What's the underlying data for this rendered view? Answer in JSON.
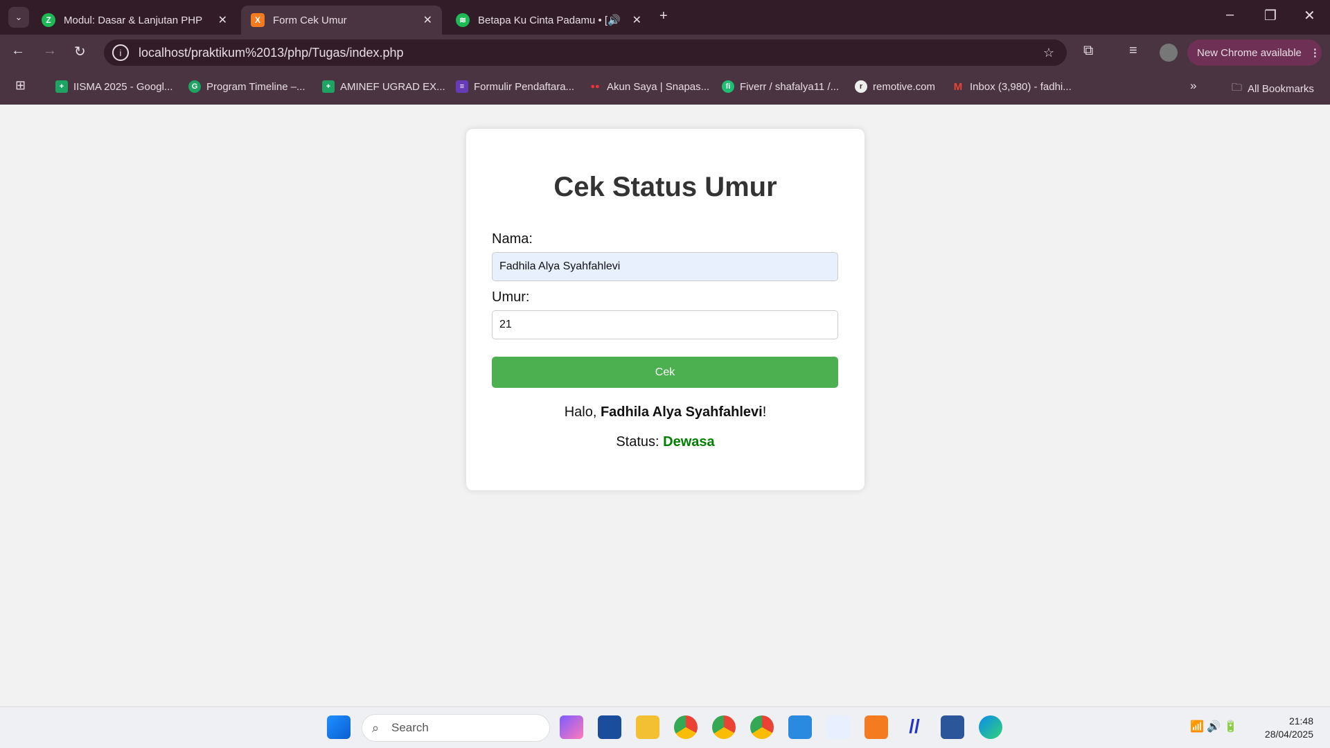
{
  "browser": {
    "tabs": [
      {
        "title": "Modul: Dasar & Lanjutan PHP",
        "icon": "z-icon"
      },
      {
        "title": "Form Cek Umur",
        "icon": "xampp-icon"
      },
      {
        "title": "Betapa Ku Cinta Padamu • [",
        "icon": "spotify-icon"
      }
    ],
    "url": "localhost/praktikum%2013/php/Tugas/index.php",
    "update_label": "New Chrome available",
    "bookmarks": [
      "IISMA 2025 - Googl...",
      "Program Timeline –...",
      "AMINEF UGRAD EX...",
      "Formulir Pendaftara...",
      "Akun Saya | Snapas...",
      "Fiverr / shafalya11 /...",
      "remotive.com",
      "Inbox (3,980) - fadhi..."
    ],
    "all_bookmarks": "All Bookmarks"
  },
  "form": {
    "title": "Cek Status Umur",
    "name_label": "Nama:",
    "name_value": "Fadhila Alya Syahfahlevi",
    "age_label": "Umur:",
    "age_value": "21",
    "submit": "Cek",
    "greeting_prefix": "Halo, ",
    "greeting_name": "Fadhila Alya Syahfahlevi",
    "greeting_suffix": "!",
    "status_label": "Status: ",
    "status_value": "Dewasa",
    "status_color": "#008000"
  },
  "taskbar": {
    "search": "Search",
    "time": "21:48",
    "date": "28/04/2025"
  }
}
